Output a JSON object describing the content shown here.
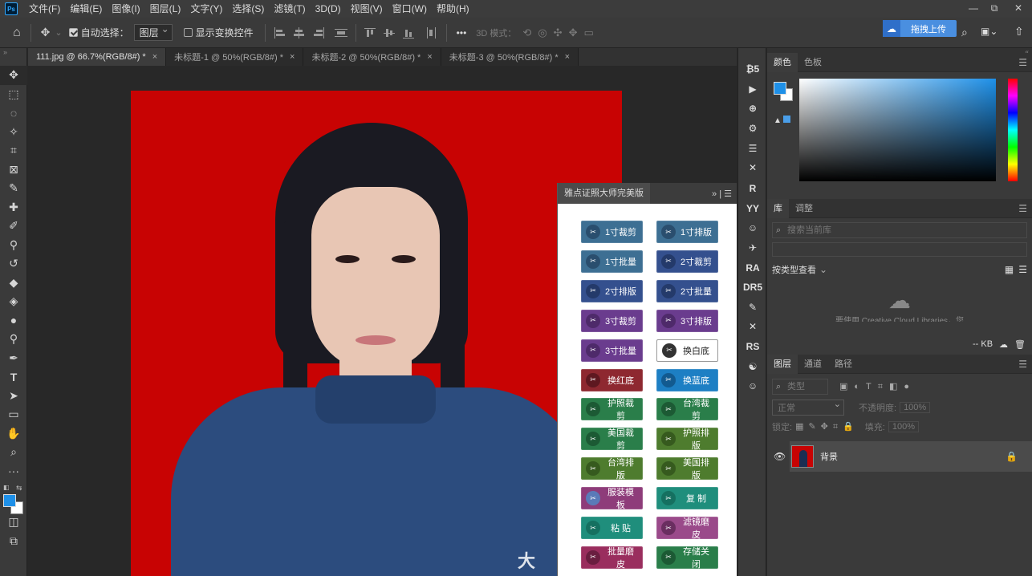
{
  "app": {
    "logo": "Ps",
    "menu": [
      "文件(F)",
      "编辑(E)",
      "图像(I)",
      "图层(L)",
      "文字(Y)",
      "选择(S)",
      "滤镜(T)",
      "3D(D)",
      "视图(V)",
      "窗口(W)",
      "帮助(H)"
    ]
  },
  "options": {
    "auto_select_label": "自动选择：",
    "auto_select_value": "图层",
    "show_transform_label": "显示变换控件",
    "mode_3d_label": "3D 模式：",
    "more_label": "•••",
    "upload_label": "拖拽上传"
  },
  "tabs": [
    {
      "label": "111.jpg @ 66.7%(RGB/8#) *",
      "close": "×"
    },
    {
      "label": "未标题-1 @ 50%(RGB/8#) *",
      "close": "×"
    },
    {
      "label": "未标题-2 @ 50%(RGB/8#) *",
      "close": "×"
    },
    {
      "label": "未标题-3 @ 50%(RGB/8#) *",
      "close": "×"
    }
  ],
  "canvas": {
    "watermark": "大"
  },
  "plugin": {
    "title": "雅点证照大师完美版",
    "buttons": [
      {
        "label": "1寸裁剪",
        "color": "#3d6f93",
        "icon_color": "#2a4e6e"
      },
      {
        "label": "1寸排版",
        "color": "#3d6f93",
        "icon_color": "#2a4e6e"
      },
      {
        "label": "1寸批量",
        "color": "#3d6f93",
        "icon_color": "#2a4e6e"
      },
      {
        "label": "2寸裁剪",
        "color": "#34508e",
        "icon_color": "#243a6a"
      },
      {
        "label": "2寸排版",
        "color": "#34508e",
        "icon_color": "#243a6a"
      },
      {
        "label": "2寸批量",
        "color": "#34508e",
        "icon_color": "#243a6a"
      },
      {
        "label": "3寸裁剪",
        "color": "#6a3c8e",
        "icon_color": "#4e2a6a"
      },
      {
        "label": "3寸排版",
        "color": "#6a3c8e",
        "icon_color": "#4e2a6a"
      },
      {
        "label": "3寸批量",
        "color": "#6a3c8e",
        "icon_color": "#4e2a6a"
      },
      {
        "label": "换白底",
        "color": "#ffffff",
        "icon_color": "#333333"
      },
      {
        "label": "换红底",
        "color": "#8e2830",
        "icon_color": "#5e1820"
      },
      {
        "label": "换蓝底",
        "color": "#1d7fc4",
        "icon_color": "#125a90"
      },
      {
        "label": "护照裁剪",
        "color": "#2a7e4a",
        "icon_color": "#1c5a34"
      },
      {
        "label": "台湾裁剪",
        "color": "#2a7e4a",
        "icon_color": "#1c5a34"
      },
      {
        "label": "美国裁剪",
        "color": "#2a7e4a",
        "icon_color": "#1c5a34"
      },
      {
        "label": "护照排版",
        "color": "#4e7c2e",
        "icon_color": "#365a1e"
      },
      {
        "label": "台湾排版",
        "color": "#4e7c2e",
        "icon_color": "#365a1e"
      },
      {
        "label": "美国排版",
        "color": "#4e7c2e",
        "icon_color": "#365a1e"
      },
      {
        "label": "服装模板",
        "color": "#8e3c7a",
        "icon_color": "#5a7ab8"
      },
      {
        "label": "复  制",
        "color": "#1f8e7c",
        "icon_color": "#157060"
      },
      {
        "label": "粘  贴",
        "color": "#1f8e7c",
        "icon_color": "#157060"
      },
      {
        "label": "滤镜磨皮",
        "color": "#9a4a8a",
        "icon_color": "#6a2e60"
      },
      {
        "label": "批量磨皮",
        "color": "#9a2e5e",
        "icon_color": "#6a1e40"
      },
      {
        "label": "存储关闭",
        "color": "#2a7e4a",
        "icon_color": "#1c5a34"
      }
    ]
  },
  "strip": [
    "₿5",
    "▶",
    "⊕",
    "⚙",
    "☰",
    "✕",
    "R",
    "YY",
    "☺",
    "✈",
    "RA",
    "DR5",
    "✎",
    "✕",
    "RS",
    "☯",
    "☺"
  ],
  "color_panel": {
    "tab_color": "颜色",
    "tab_swatches": "色板"
  },
  "lib_panel": {
    "tab_lib": "库",
    "tab_adjust": "调整",
    "search_placeholder": "搜索当前库",
    "view_label": "按类型查看",
    "cc_text": "要使用 Creative Cloud Libraries，您",
    "kb_label": "-- KB"
  },
  "layers_panel": {
    "tab_layers": "图层",
    "tab_channels": "通道",
    "tab_paths": "路径",
    "filter_label": "类型",
    "blend_mode": "正常",
    "opacity_label": "不透明度:",
    "opacity_value": "100%",
    "lock_label": "锁定:",
    "fill_label": "填充:",
    "fill_value": "100%",
    "layer_name": "背景"
  }
}
